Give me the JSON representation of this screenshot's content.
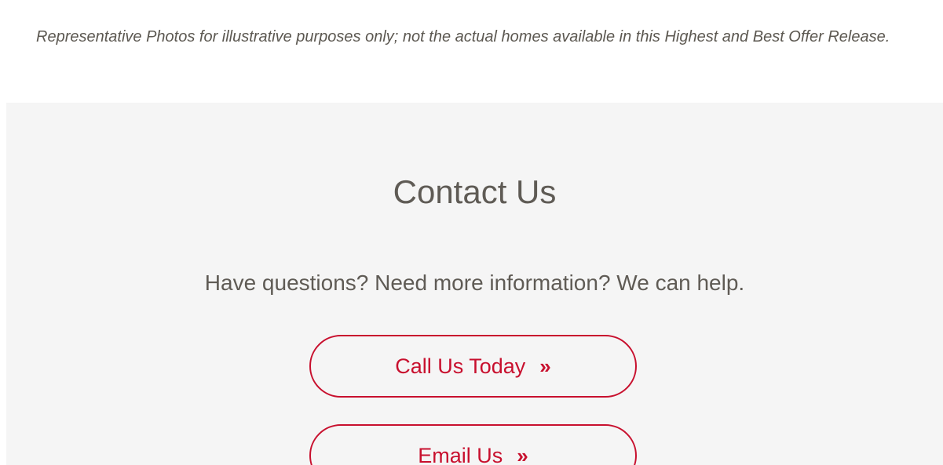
{
  "disclaimer": {
    "text": "Representative Photos for illustrative purposes only; not the actual homes available in this Highest and Best Offer Release."
  },
  "contact": {
    "title": "Contact Us",
    "subtitle": "Have questions? Need more information? We can help.",
    "call_button": {
      "label": "Call Us Today",
      "icon": "»"
    },
    "email_button": {
      "label": "Email Us",
      "icon": "»"
    }
  },
  "colors": {
    "accent": "#c8102e",
    "text": "#5f5b55",
    "section_background": "#f5f5f5",
    "page_background": "#ffffff"
  }
}
